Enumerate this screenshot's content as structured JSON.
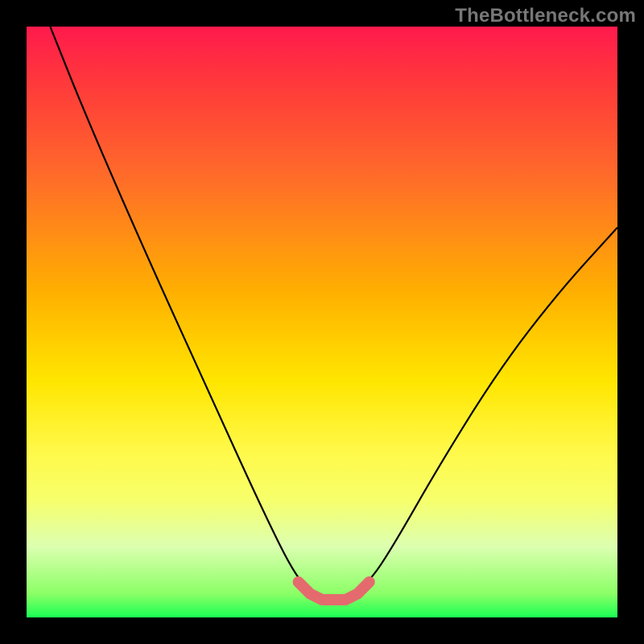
{
  "watermark": "TheBottleneck.com",
  "chart_data": {
    "type": "line",
    "title": "",
    "xlabel": "",
    "ylabel": "",
    "xlim": [
      0,
      100
    ],
    "ylim": [
      0,
      100
    ],
    "grid": false,
    "legend": false,
    "series": [
      {
        "name": "bottleneck-curve",
        "style": "solid-black-thin",
        "x": [
          4,
          10,
          20,
          30,
          40,
          46,
          50,
          54,
          58,
          62,
          70,
          80,
          90,
          100
        ],
        "y": [
          100,
          85,
          62,
          40,
          18,
          6,
          3,
          3,
          6,
          12,
          26,
          42,
          55,
          66
        ]
      },
      {
        "name": "valley-highlight",
        "style": "solid-pink-thick",
        "x": [
          46,
          48,
          50,
          52,
          54,
          56,
          58
        ],
        "y": [
          6,
          4,
          3,
          3,
          3,
          4,
          6
        ]
      }
    ],
    "background_gradient": {
      "direction": "top-to-bottom",
      "stops": [
        {
          "pos": 0.0,
          "color": "#ff1a4d"
        },
        {
          "pos": 0.25,
          "color": "#ff6a2a"
        },
        {
          "pos": 0.6,
          "color": "#ffe600"
        },
        {
          "pos": 0.88,
          "color": "#dcffb0"
        },
        {
          "pos": 1.0,
          "color": "#1aff54"
        }
      ]
    }
  }
}
